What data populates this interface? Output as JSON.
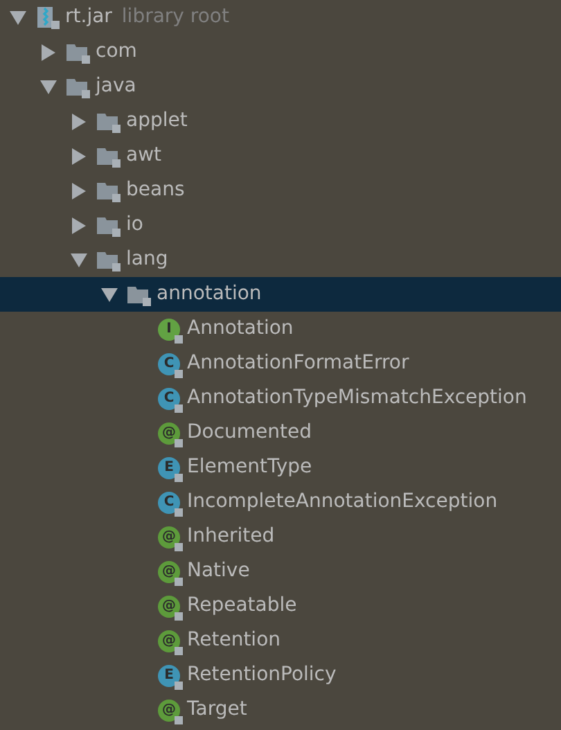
{
  "tree": [
    {
      "label": "rt.jar",
      "note": "library root",
      "kind": "jar",
      "expanded": true,
      "selected": false,
      "children": [
        {
          "label": "com",
          "kind": "package",
          "expanded": false,
          "selected": false
        },
        {
          "label": "java",
          "kind": "package",
          "expanded": true,
          "selected": false,
          "children": [
            {
              "label": "applet",
              "kind": "package",
              "expanded": false,
              "selected": false
            },
            {
              "label": "awt",
              "kind": "package",
              "expanded": false,
              "selected": false
            },
            {
              "label": "beans",
              "kind": "package",
              "expanded": false,
              "selected": false
            },
            {
              "label": "io",
              "kind": "package",
              "expanded": false,
              "selected": false
            },
            {
              "label": "lang",
              "kind": "package",
              "expanded": true,
              "selected": false,
              "children": [
                {
                  "label": "annotation",
                  "kind": "package",
                  "expanded": true,
                  "selected": true,
                  "children": [
                    {
                      "label": "Annotation",
                      "kind": "interface",
                      "badge": "I",
                      "selected": false
                    },
                    {
                      "label": "AnnotationFormatError",
                      "kind": "class",
                      "badge": "C",
                      "selected": false
                    },
                    {
                      "label": "AnnotationTypeMismatchException",
                      "kind": "class",
                      "badge": "C",
                      "selected": false
                    },
                    {
                      "label": "Documented",
                      "kind": "annotation",
                      "badge": "@",
                      "selected": false
                    },
                    {
                      "label": "ElementType",
                      "kind": "enum",
                      "badge": "E",
                      "selected": false
                    },
                    {
                      "label": "IncompleteAnnotationException",
                      "kind": "class",
                      "badge": "C",
                      "selected": false
                    },
                    {
                      "label": "Inherited",
                      "kind": "annotation",
                      "badge": "@",
                      "selected": false
                    },
                    {
                      "label": "Native",
                      "kind": "annotation",
                      "badge": "@",
                      "selected": false
                    },
                    {
                      "label": "Repeatable",
                      "kind": "annotation",
                      "badge": "@",
                      "selected": false
                    },
                    {
                      "label": "Retention",
                      "kind": "annotation",
                      "badge": "@",
                      "selected": false
                    },
                    {
                      "label": "RetentionPolicy",
                      "kind": "enum",
                      "badge": "E",
                      "selected": false
                    },
                    {
                      "label": "Target",
                      "kind": "annotation",
                      "badge": "@",
                      "selected": false
                    }
                  ]
                }
              ]
            }
          ]
        }
      ]
    }
  ]
}
